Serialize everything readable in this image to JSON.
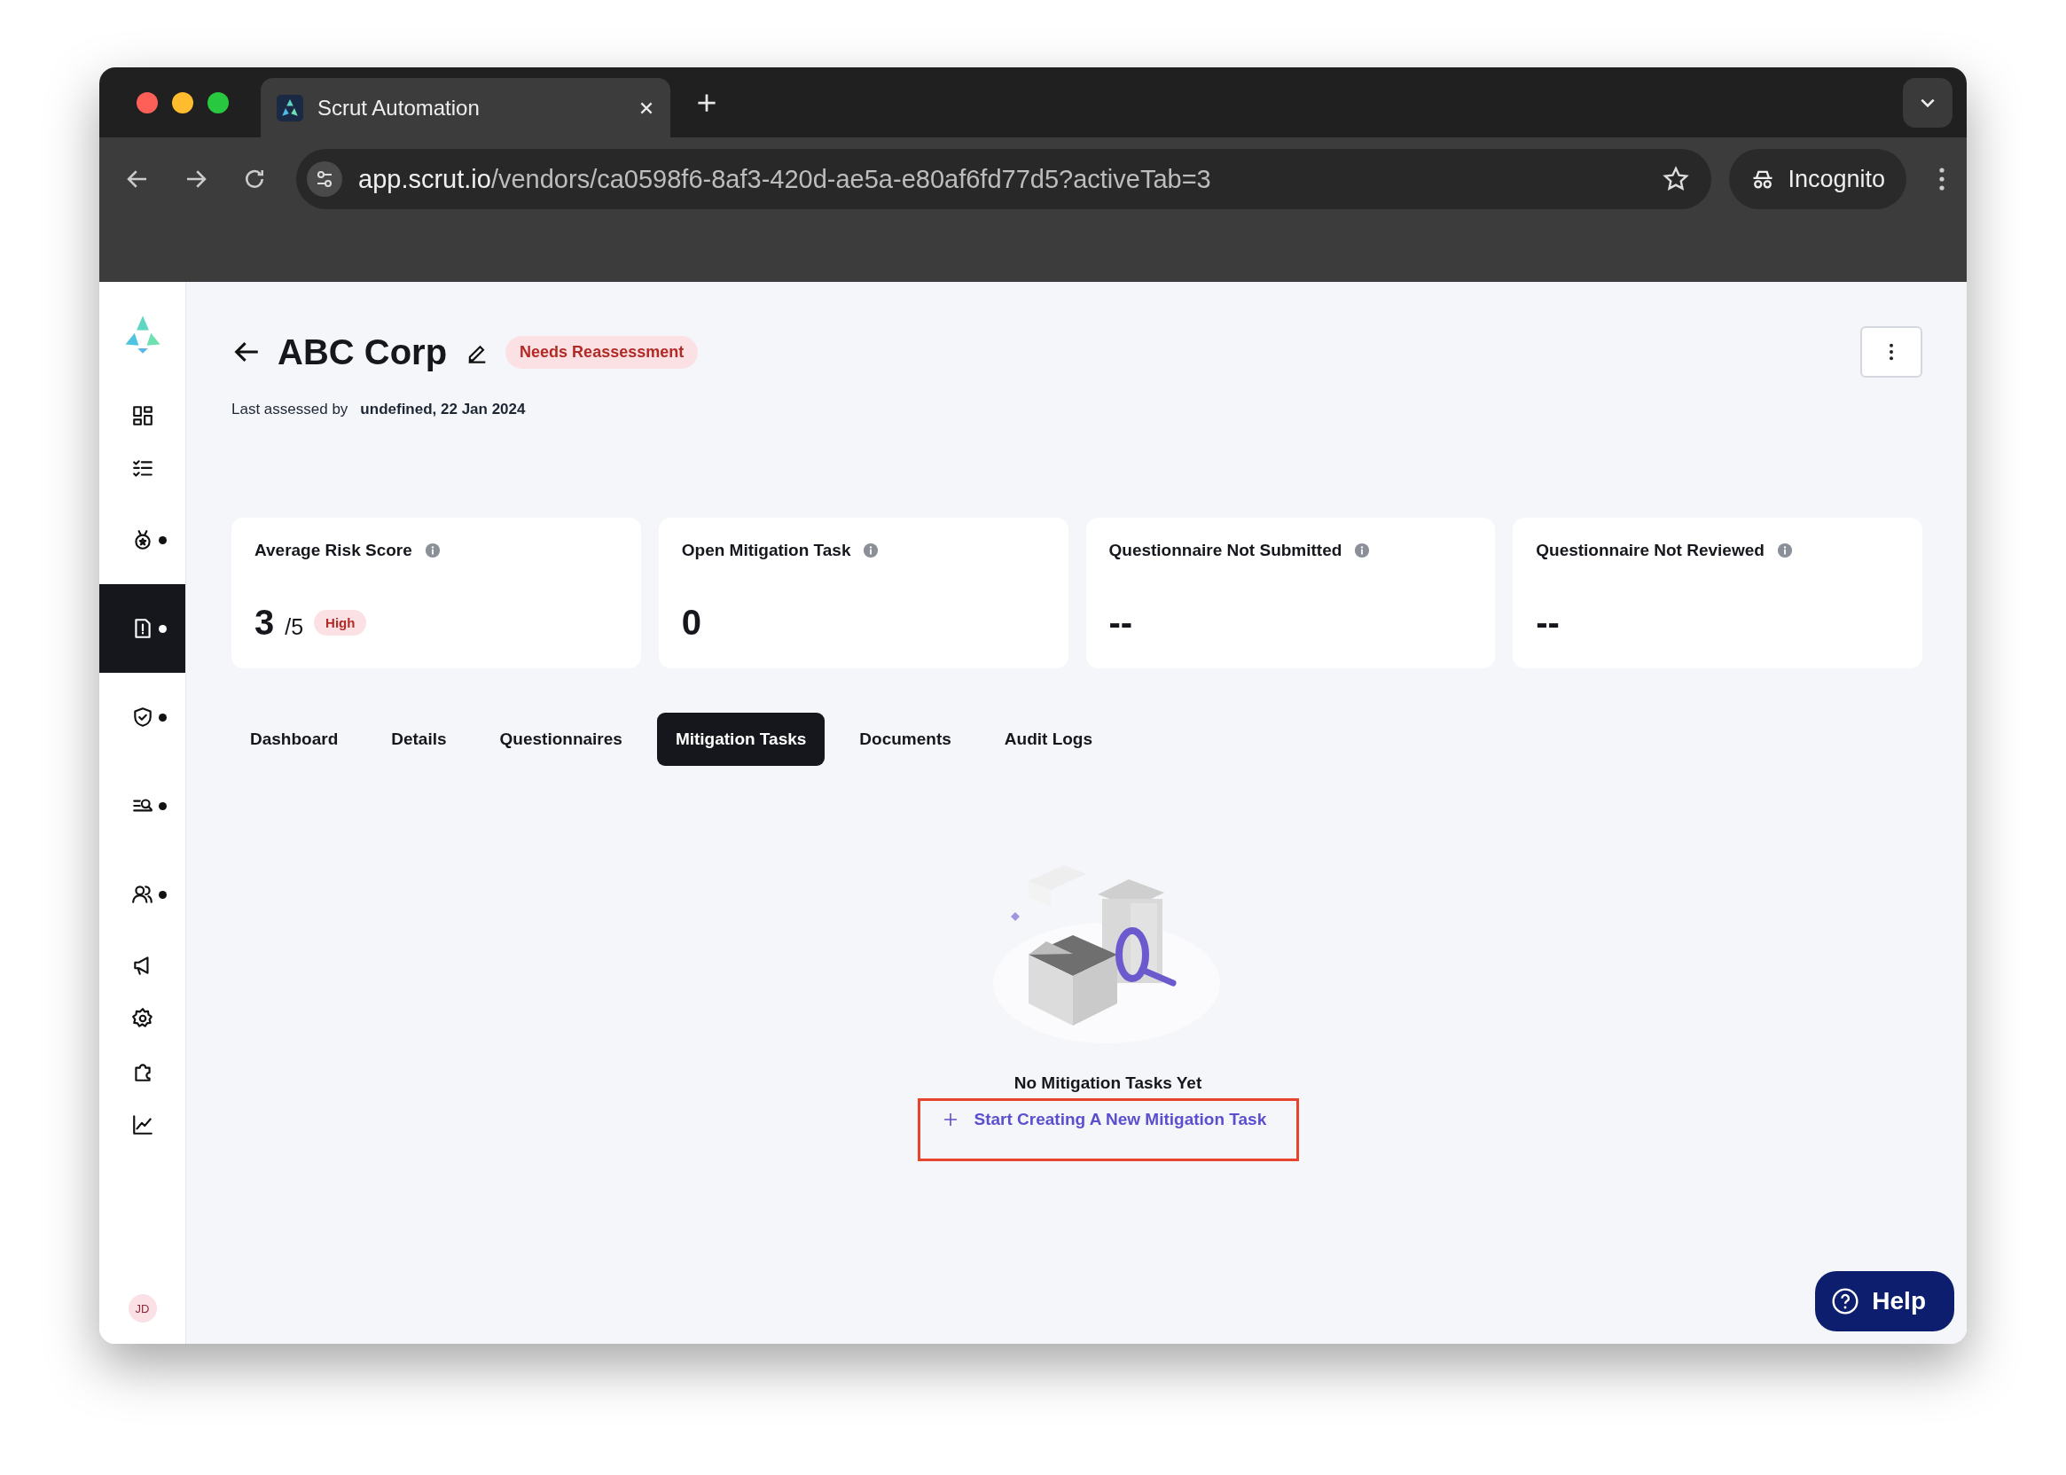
{
  "browser": {
    "tab_title": "Scrut Automation",
    "url_host": "app.scrut.io",
    "url_path": "/vendors/ca0598f6-8af3-420d-ae5a-e80af6fd77d5?activeTab=3",
    "profile": "Incognito"
  },
  "sidebar": {
    "items": [
      {
        "selected": false,
        "dot": false
      },
      {
        "selected": false,
        "dot": false
      },
      {
        "selected": false,
        "dot": true
      },
      {
        "selected": true,
        "dot": true
      },
      {
        "selected": false,
        "dot": true
      },
      {
        "selected": false,
        "dot": true
      },
      {
        "selected": false,
        "dot": true
      },
      {
        "selected": false,
        "dot": false
      },
      {
        "selected": false,
        "dot": false
      },
      {
        "selected": false,
        "dot": false
      },
      {
        "selected": false,
        "dot": false
      }
    ],
    "avatar": "JD"
  },
  "header": {
    "title": "ABC Corp",
    "status": "Needs Reassessment",
    "assessed_label": "Last assessed by",
    "assessed_value": "undefined, 22 Jan 2024"
  },
  "cards": [
    {
      "title": "Average Risk Score",
      "value": "3",
      "suffix": "/5",
      "badge": "High"
    },
    {
      "title": "Open Mitigation Task",
      "value": "0"
    },
    {
      "title": "Questionnaire Not Submitted",
      "value": "--"
    },
    {
      "title": "Questionnaire Not Reviewed",
      "value": "--"
    }
  ],
  "tabs": [
    {
      "label": "Dashboard",
      "selected": false
    },
    {
      "label": "Details",
      "selected": false
    },
    {
      "label": "Questionnaires",
      "selected": false
    },
    {
      "label": "Mitigation Tasks",
      "selected": true
    },
    {
      "label": "Documents",
      "selected": false
    },
    {
      "label": "Audit Logs",
      "selected": false
    }
  ],
  "empty_state": {
    "message": "No Mitigation Tasks Yet",
    "action": "Start Creating A New Mitigation Task",
    "highlighted": true
  },
  "help_button": "Help"
}
